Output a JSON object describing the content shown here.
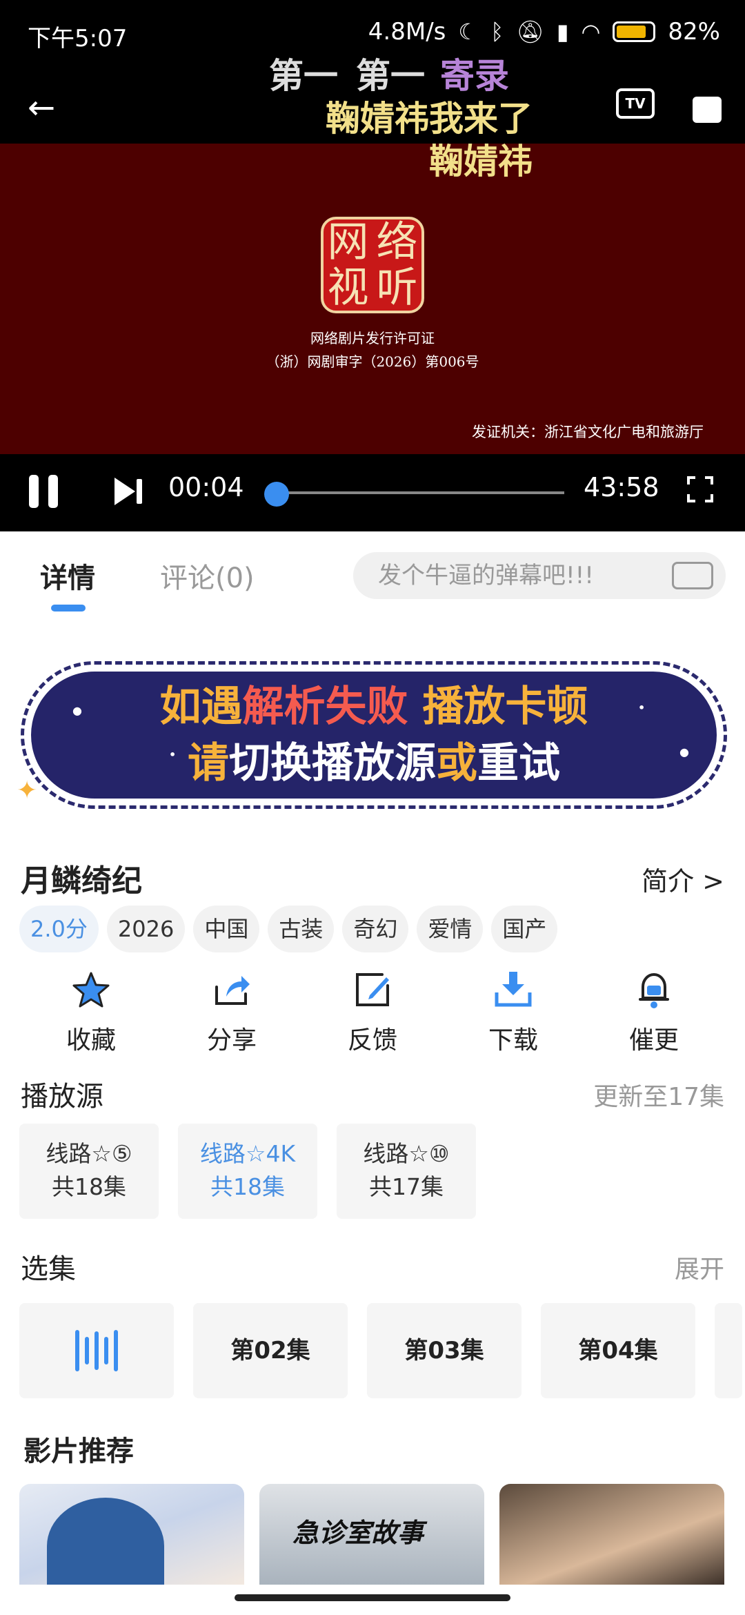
{
  "status_bar": {
    "time": "下午5:07",
    "network_speed": "4.8M/s",
    "battery": "82%"
  },
  "video": {
    "danmaku": [
      "第一",
      "第一",
      "寄录",
      "鞠婧祎我来了",
      "鞠婧祎"
    ],
    "tv_label": "TV",
    "seal_chars": [
      "网",
      "络",
      "视",
      "听"
    ],
    "license_line1": "网络剧片发行许可证",
    "license_line2": "（浙）网剧审字（2026）第006号",
    "issuer": "发证机关：浙江省文化广电和旅游厅",
    "current_time": "00:04",
    "duration": "43:58",
    "progress": 0.002
  },
  "tabs": {
    "details": "详情",
    "comments": "评论(0)"
  },
  "danmaku_input": {
    "placeholder": "发个牛逼的弹幕吧!!!"
  },
  "banner": {
    "line1_a": "如遇",
    "line1_b": "解析失败",
    "line1_c": "播放卡顿",
    "line2_a": "请",
    "line2_b": "切换播放源",
    "line2_c": "或",
    "line2_d": "重试"
  },
  "show": {
    "title": "月鳞绮纪",
    "intro_link": "简介 >",
    "tags": [
      "2.0分",
      "2026",
      "中国",
      "古装",
      "奇幻",
      "爱情",
      "国产"
    ]
  },
  "actions": [
    {
      "label": "收藏",
      "icon": "star-icon"
    },
    {
      "label": "分享",
      "icon": "share-icon"
    },
    {
      "label": "反馈",
      "icon": "edit-icon"
    },
    {
      "label": "下载",
      "icon": "download-icon"
    },
    {
      "label": "催更",
      "icon": "bell-icon"
    }
  ],
  "sources": {
    "title": "播放源",
    "update_status": "更新至17集",
    "items": [
      {
        "name": "线路☆⑤",
        "count": "共18集"
      },
      {
        "name": "线路☆4K",
        "count": "共18集"
      },
      {
        "name": "线路☆⑩",
        "count": "共17集"
      }
    ]
  },
  "episodes": {
    "title": "选集",
    "expand": "展开",
    "items": [
      "第02集",
      "第03集",
      "第04集"
    ]
  },
  "recommendations": {
    "title": "影片推荐",
    "item2_title": "急诊室故事"
  },
  "colors": {
    "accent": "#3a8ef0",
    "banner_bg": "#252469",
    "banner_yellow": "#f7b23b",
    "banner_red": "#f55b4f",
    "video_bg": "#4d0000"
  }
}
